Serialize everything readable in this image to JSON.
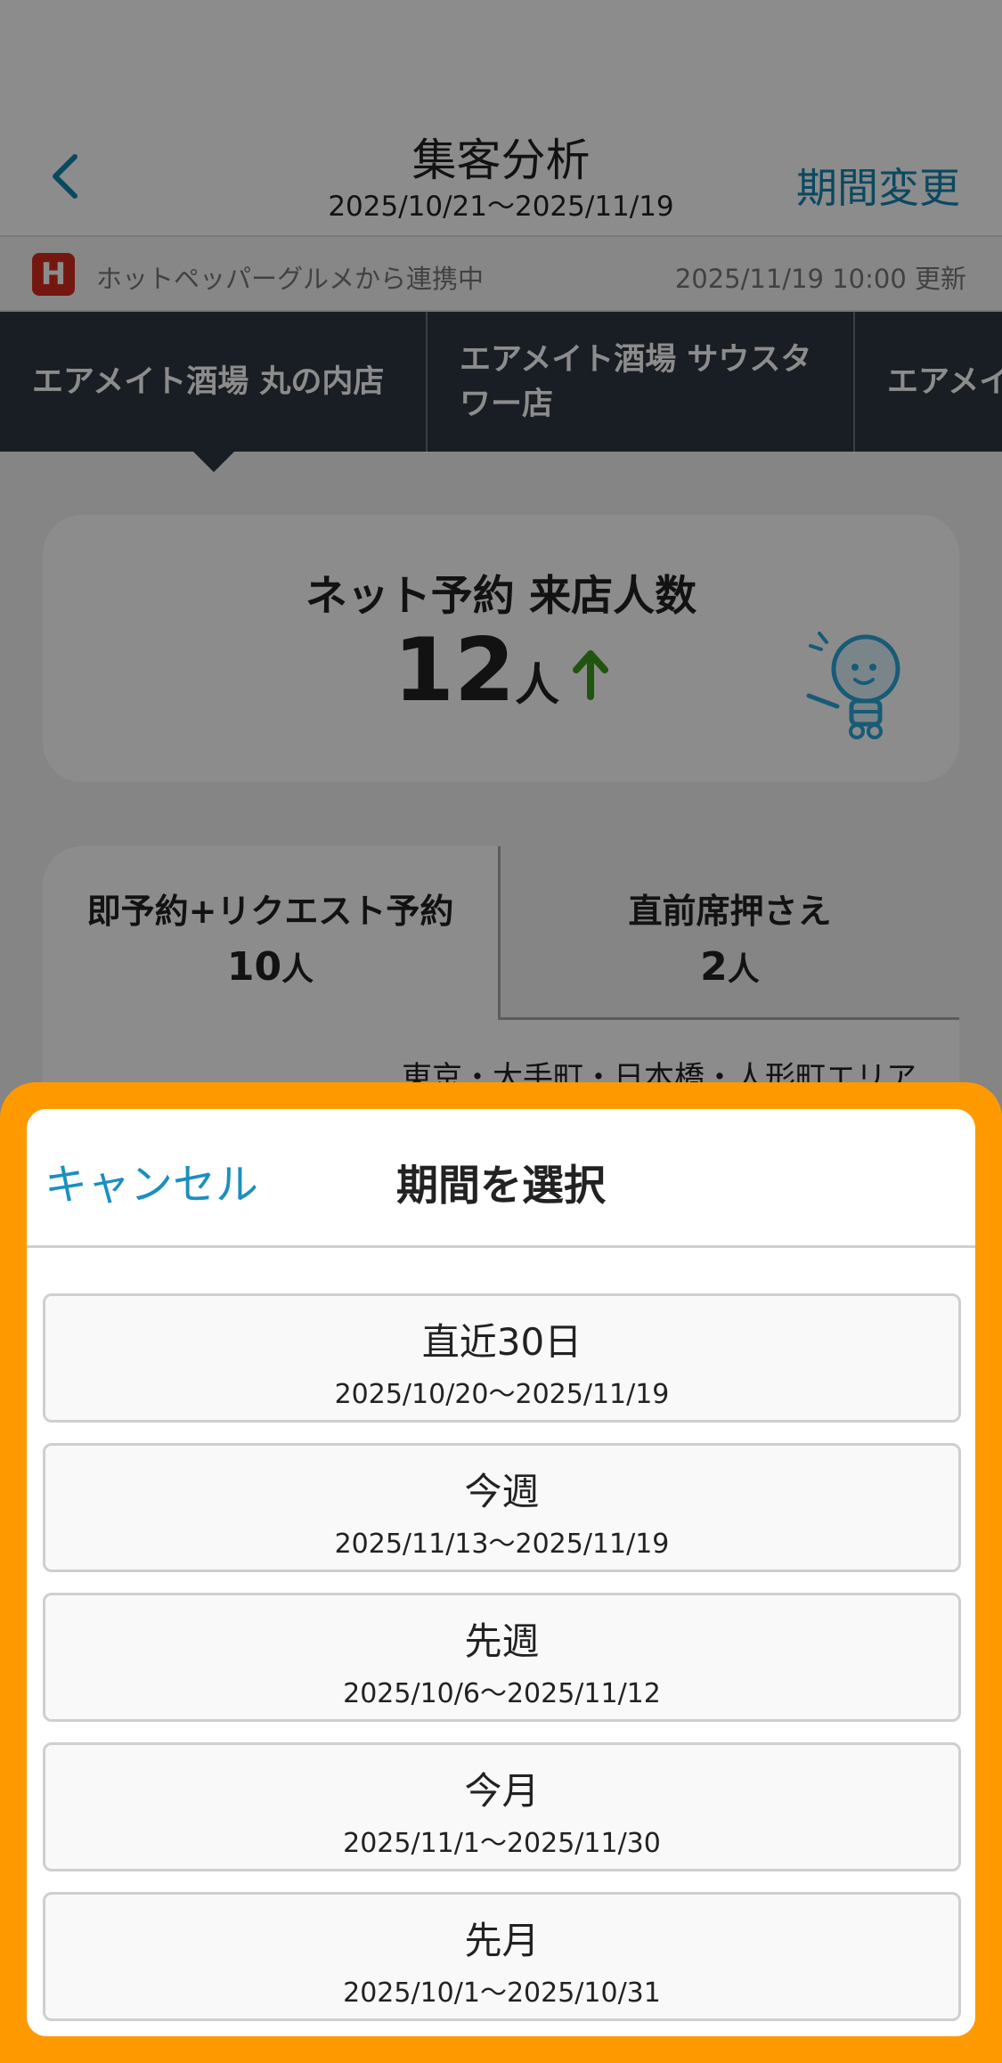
{
  "header": {
    "title": "集客分析",
    "date_range": "2025/10/21〜2025/11/19",
    "period_change_label": "期間変更"
  },
  "sync": {
    "logo_letter": "H",
    "text": "ホットペッパーグルメから連携中",
    "updated": "2025/11/19 10:00 更新"
  },
  "stores": [
    {
      "name": "エアメイト酒場 丸の内店"
    },
    {
      "name": "エアメイト酒場 サウスタワー店"
    },
    {
      "name": "エアメイ"
    }
  ],
  "visitors": {
    "title": "ネット予約 来店人数",
    "value": "12",
    "unit": "人",
    "trend": "up"
  },
  "breakdown": {
    "left": {
      "label": "即予約+リクエスト予約",
      "value": "10",
      "unit": "人"
    },
    "right": {
      "label": "直前席押さえ",
      "value": "2",
      "unit": "人"
    },
    "area": "東京・大手町・日本橋・人形町エリア"
  },
  "sheet": {
    "cancel_label": "キャンセル",
    "title": "期間を選択",
    "options": [
      {
        "label": "直近30日",
        "range": "2025/10/20〜2025/11/19"
      },
      {
        "label": "今週",
        "range": "2025/11/13〜2025/11/19"
      },
      {
        "label": "先週",
        "range": "2025/10/6〜2025/11/12"
      },
      {
        "label": "今月",
        "range": "2025/11/1〜2025/11/30"
      },
      {
        "label": "先月",
        "range": "2025/10/1〜2025/10/31"
      }
    ]
  },
  "colors": {
    "accent_blue": "#1385b0",
    "highlight_orange": "#ff9900",
    "store_tab_bg": "#2d3741",
    "trend_green": "#3d9a1d",
    "hotpepper_red": "#d62a20"
  },
  "icons": {
    "back": "chevron-left-icon",
    "trend": "arrow-up-icon",
    "mascot": "lightbulb-mascot-icon",
    "hotpepper": "hotpepper-logo-icon"
  }
}
